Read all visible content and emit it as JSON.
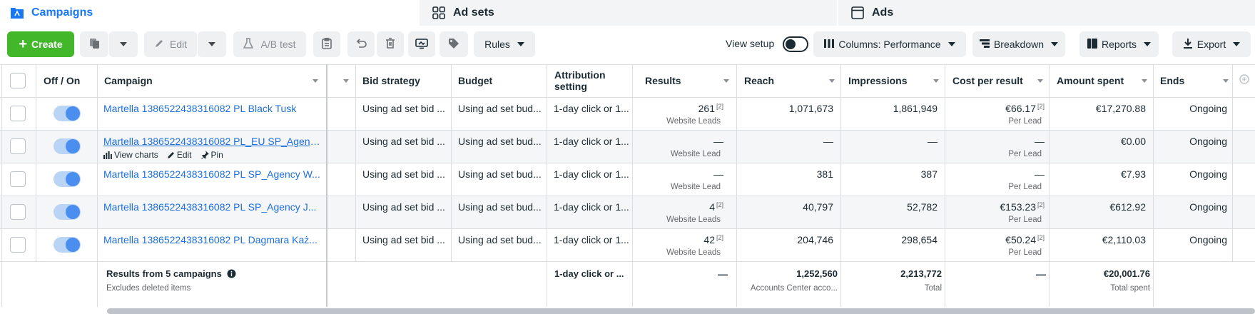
{
  "tabs": [
    {
      "label": "Campaigns",
      "icon": "folder-icon"
    },
    {
      "label": "Ad sets",
      "icon": "grid-icon"
    },
    {
      "label": "Ads",
      "icon": "ad-window-icon"
    }
  ],
  "toolbar": {
    "create": "Create",
    "edit": "Edit",
    "ab_test": "A/B test",
    "rules": "Rules",
    "view_setup": "View setup",
    "columns": "Columns: Performance",
    "breakdown": "Breakdown",
    "reports": "Reports",
    "export": "Export"
  },
  "columns": {
    "off_on": "Off / On",
    "campaign": "Campaign",
    "bid_strategy": "Bid strategy",
    "budget": "Budget",
    "attribution_1": "Attribution",
    "attribution_2": "setting",
    "results": "Results",
    "reach": "Reach",
    "impressions": "Impressions",
    "cost_per_result": "Cost per result",
    "amount_spent": "Amount spent",
    "ends": "Ends"
  },
  "rows": [
    {
      "campaign": "Martella 1386522438316082 PL Black Tusk",
      "bid": "Using ad set bid ...",
      "budget": "Using ad set bud...",
      "attribution": "1-day click or 1...",
      "results": "261",
      "results_sup": "[2]",
      "results_sub": "Website Leads",
      "reach": "1,071,673",
      "impressions": "1,861,949",
      "cpr": "€66.17",
      "cpr_sup": "[2]",
      "cpr_sub": "Per Lead",
      "spent": "€17,270.88",
      "ends": "Ongoing"
    },
    {
      "campaign": "Martella 1386522438316082 PL_EU SP_Agenc...",
      "bid": "Using ad set bid ...",
      "budget": "Using ad set bud...",
      "attribution": "1-day click or 1...",
      "results": "—",
      "results_sup": "",
      "results_sub": "Website Lead",
      "reach": "—",
      "impressions": "—",
      "cpr": "—",
      "cpr_sup": "",
      "cpr_sub": "Per Lead",
      "spent": "€0.00",
      "ends": "Ongoing"
    },
    {
      "campaign": "Martella 1386522438316082 PL SP_Agency W...",
      "bid": "Using ad set bid ...",
      "budget": "Using ad set bud...",
      "attribution": "1-day click or 1...",
      "results": "—",
      "results_sup": "",
      "results_sub": "Website Lead",
      "reach": "381",
      "impressions": "387",
      "cpr": "—",
      "cpr_sup": "",
      "cpr_sub": "Per Lead",
      "spent": "€7.93",
      "ends": "Ongoing"
    },
    {
      "campaign": "Martella 1386522438316082 PL SP_Agency J...",
      "bid": "Using ad set bid ...",
      "budget": "Using ad set bud...",
      "attribution": "1-day click or 1...",
      "results": "4",
      "results_sup": "[2]",
      "results_sub": "Website Leads",
      "reach": "40,797",
      "impressions": "52,782",
      "cpr": "€153.23",
      "cpr_sup": "[2]",
      "cpr_sub": "Per Lead",
      "spent": "€612.92",
      "ends": "Ongoing"
    },
    {
      "campaign": "Martella 1386522438316082 PL Dagmara Każ...",
      "bid": "Using ad set bid ...",
      "budget": "Using ad set bud...",
      "attribution": "1-day click or 1...",
      "results": "42",
      "results_sup": "[2]",
      "results_sub": "Website Leads",
      "reach": "204,746",
      "impressions": "298,654",
      "cpr": "€50.24",
      "cpr_sup": "[2]",
      "cpr_sub": "Per Lead",
      "spent": "€2,110.03",
      "ends": "Ongoing"
    }
  ],
  "row_actions": {
    "view_charts": "View charts",
    "edit": "Edit",
    "pin": "Pin"
  },
  "summary": {
    "title": "Results from 5 campaigns",
    "subtitle": "Excludes deleted items",
    "attribution": "1-day click or ...",
    "results": "—",
    "reach": "1,252,560",
    "reach_sub": "Accounts Center acco...",
    "impressions": "2,213,772",
    "impressions_sub": "Total",
    "cpr": "—",
    "spent": "€20,001.76",
    "spent_sub": "Total spent"
  }
}
